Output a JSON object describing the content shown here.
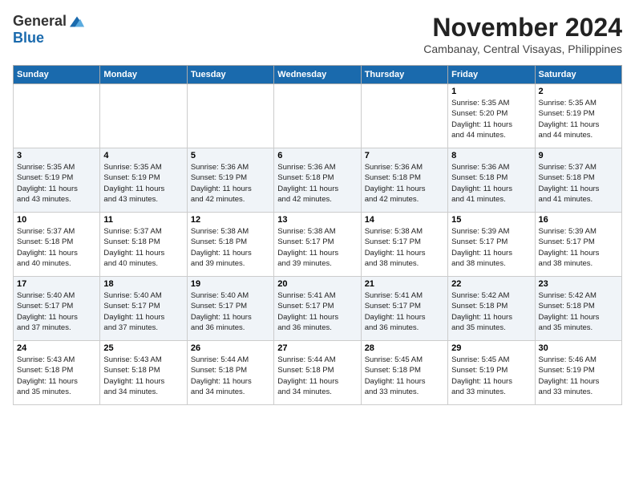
{
  "header": {
    "logo_general": "General",
    "logo_blue": "Blue",
    "month": "November 2024",
    "location": "Cambanay, Central Visayas, Philippines"
  },
  "weekdays": [
    "Sunday",
    "Monday",
    "Tuesday",
    "Wednesday",
    "Thursday",
    "Friday",
    "Saturday"
  ],
  "weeks": [
    [
      {
        "day": "",
        "info": ""
      },
      {
        "day": "",
        "info": ""
      },
      {
        "day": "",
        "info": ""
      },
      {
        "day": "",
        "info": ""
      },
      {
        "day": "",
        "info": ""
      },
      {
        "day": "1",
        "info": "Sunrise: 5:35 AM\nSunset: 5:20 PM\nDaylight: 11 hours\nand 44 minutes."
      },
      {
        "day": "2",
        "info": "Sunrise: 5:35 AM\nSunset: 5:19 PM\nDaylight: 11 hours\nand 44 minutes."
      }
    ],
    [
      {
        "day": "3",
        "info": "Sunrise: 5:35 AM\nSunset: 5:19 PM\nDaylight: 11 hours\nand 43 minutes."
      },
      {
        "day": "4",
        "info": "Sunrise: 5:35 AM\nSunset: 5:19 PM\nDaylight: 11 hours\nand 43 minutes."
      },
      {
        "day": "5",
        "info": "Sunrise: 5:36 AM\nSunset: 5:19 PM\nDaylight: 11 hours\nand 42 minutes."
      },
      {
        "day": "6",
        "info": "Sunrise: 5:36 AM\nSunset: 5:18 PM\nDaylight: 11 hours\nand 42 minutes."
      },
      {
        "day": "7",
        "info": "Sunrise: 5:36 AM\nSunset: 5:18 PM\nDaylight: 11 hours\nand 42 minutes."
      },
      {
        "day": "8",
        "info": "Sunrise: 5:36 AM\nSunset: 5:18 PM\nDaylight: 11 hours\nand 41 minutes."
      },
      {
        "day": "9",
        "info": "Sunrise: 5:37 AM\nSunset: 5:18 PM\nDaylight: 11 hours\nand 41 minutes."
      }
    ],
    [
      {
        "day": "10",
        "info": "Sunrise: 5:37 AM\nSunset: 5:18 PM\nDaylight: 11 hours\nand 40 minutes."
      },
      {
        "day": "11",
        "info": "Sunrise: 5:37 AM\nSunset: 5:18 PM\nDaylight: 11 hours\nand 40 minutes."
      },
      {
        "day": "12",
        "info": "Sunrise: 5:38 AM\nSunset: 5:18 PM\nDaylight: 11 hours\nand 39 minutes."
      },
      {
        "day": "13",
        "info": "Sunrise: 5:38 AM\nSunset: 5:17 PM\nDaylight: 11 hours\nand 39 minutes."
      },
      {
        "day": "14",
        "info": "Sunrise: 5:38 AM\nSunset: 5:17 PM\nDaylight: 11 hours\nand 38 minutes."
      },
      {
        "day": "15",
        "info": "Sunrise: 5:39 AM\nSunset: 5:17 PM\nDaylight: 11 hours\nand 38 minutes."
      },
      {
        "day": "16",
        "info": "Sunrise: 5:39 AM\nSunset: 5:17 PM\nDaylight: 11 hours\nand 38 minutes."
      }
    ],
    [
      {
        "day": "17",
        "info": "Sunrise: 5:40 AM\nSunset: 5:17 PM\nDaylight: 11 hours\nand 37 minutes."
      },
      {
        "day": "18",
        "info": "Sunrise: 5:40 AM\nSunset: 5:17 PM\nDaylight: 11 hours\nand 37 minutes."
      },
      {
        "day": "19",
        "info": "Sunrise: 5:40 AM\nSunset: 5:17 PM\nDaylight: 11 hours\nand 36 minutes."
      },
      {
        "day": "20",
        "info": "Sunrise: 5:41 AM\nSunset: 5:17 PM\nDaylight: 11 hours\nand 36 minutes."
      },
      {
        "day": "21",
        "info": "Sunrise: 5:41 AM\nSunset: 5:17 PM\nDaylight: 11 hours\nand 36 minutes."
      },
      {
        "day": "22",
        "info": "Sunrise: 5:42 AM\nSunset: 5:18 PM\nDaylight: 11 hours\nand 35 minutes."
      },
      {
        "day": "23",
        "info": "Sunrise: 5:42 AM\nSunset: 5:18 PM\nDaylight: 11 hours\nand 35 minutes."
      }
    ],
    [
      {
        "day": "24",
        "info": "Sunrise: 5:43 AM\nSunset: 5:18 PM\nDaylight: 11 hours\nand 35 minutes."
      },
      {
        "day": "25",
        "info": "Sunrise: 5:43 AM\nSunset: 5:18 PM\nDaylight: 11 hours\nand 34 minutes."
      },
      {
        "day": "26",
        "info": "Sunrise: 5:44 AM\nSunset: 5:18 PM\nDaylight: 11 hours\nand 34 minutes."
      },
      {
        "day": "27",
        "info": "Sunrise: 5:44 AM\nSunset: 5:18 PM\nDaylight: 11 hours\nand 34 minutes."
      },
      {
        "day": "28",
        "info": "Sunrise: 5:45 AM\nSunset: 5:18 PM\nDaylight: 11 hours\nand 33 minutes."
      },
      {
        "day": "29",
        "info": "Sunrise: 5:45 AM\nSunset: 5:19 PM\nDaylight: 11 hours\nand 33 minutes."
      },
      {
        "day": "30",
        "info": "Sunrise: 5:46 AM\nSunset: 5:19 PM\nDaylight: 11 hours\nand 33 minutes."
      }
    ]
  ]
}
